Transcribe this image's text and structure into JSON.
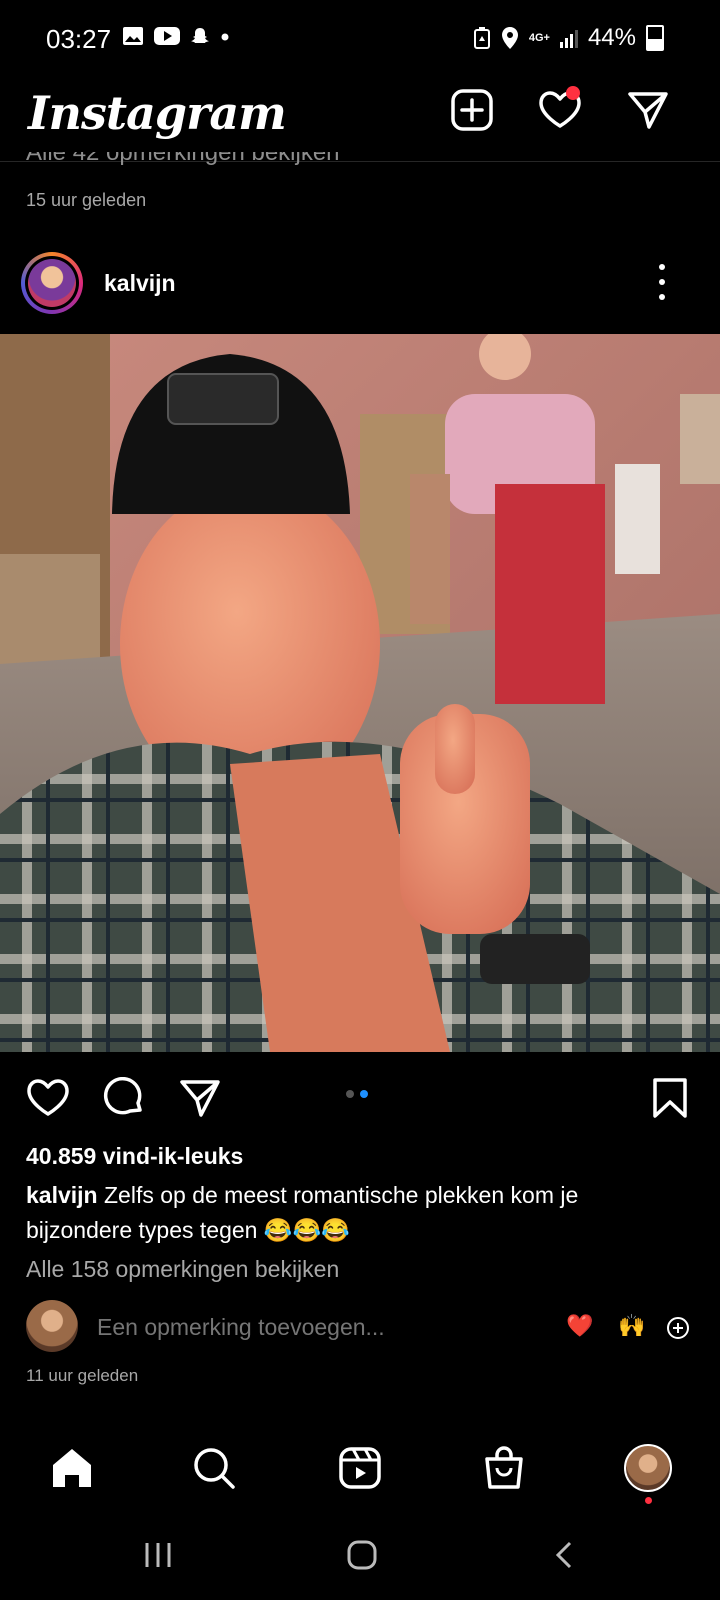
{
  "status_bar": {
    "time": "03:27",
    "network": "4G+",
    "battery": "44%",
    "left_icons": [
      "image-icon",
      "youtube-icon",
      "snapchat-icon",
      "dot-icon"
    ],
    "right_icons": [
      "battery-saver-icon",
      "location-icon",
      "signal-icon",
      "battery-icon"
    ]
  },
  "header": {
    "logo": "Instagram",
    "icons": [
      "new-post-icon",
      "activity-heart-icon",
      "direct-message-icon"
    ],
    "has_activity_notification": true
  },
  "previous_post": {
    "view_comments": "Alle 42 opmerkingen bekijken",
    "time_ago": "15 uur geleden"
  },
  "post": {
    "username": "kalvijn",
    "likes": "40.859 vind-ik-leuks",
    "caption_user": "kalvijn",
    "caption_text": "Zelfs op de meest romantische plekken kom je bijzondere types tegen 😂😂😂",
    "view_comments": "Alle 158 opmerkingen bekijken",
    "comment_placeholder": "Een opmerking toevoegen...",
    "quick_reactions": [
      "❤️",
      "🙌"
    ],
    "time_ago": "11 uur geleden",
    "carousel_count": 2,
    "carousel_active": 2
  },
  "bottom_nav": [
    "home-icon",
    "search-icon",
    "reels-icon",
    "shop-icon",
    "profile-avatar"
  ],
  "colors": {
    "background": "#000000",
    "accent_blue": "#1e90ff",
    "notification_red": "#ff3040",
    "muted_text": "#a8a8a8"
  }
}
